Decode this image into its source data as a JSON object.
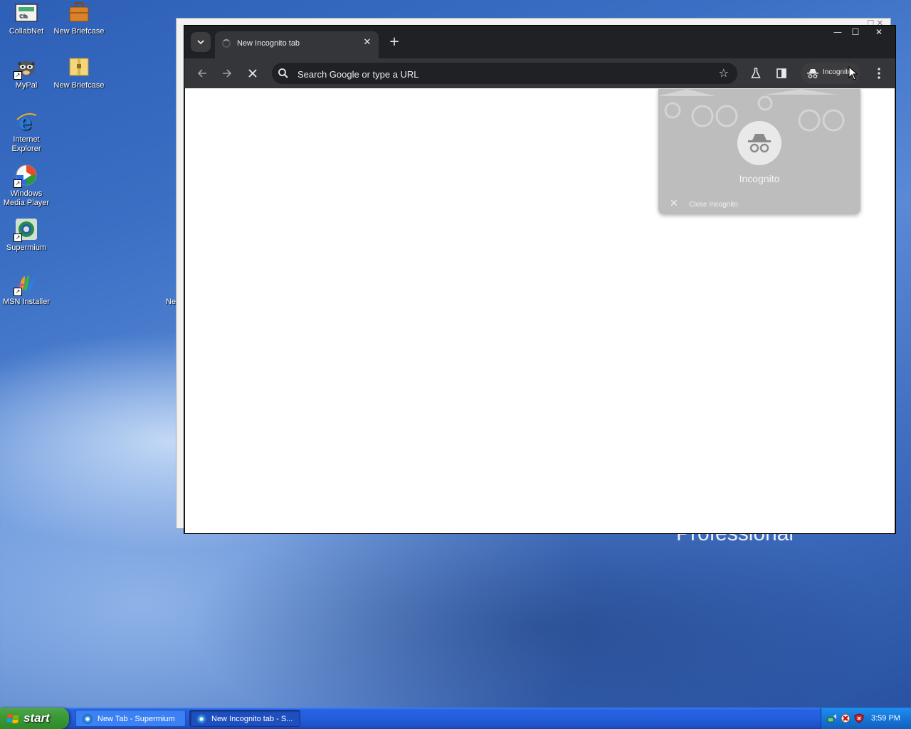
{
  "desktop": {
    "icons": [
      {
        "label": "CollabNet",
        "icon": "collabnet-icon"
      },
      {
        "label": "New Briefcase",
        "icon": "briefcase-icon"
      },
      {
        "label": "MyPal",
        "icon": "mypal-icon"
      },
      {
        "label": "New Briefcase",
        "icon": "briefcase-icon"
      },
      {
        "label": "Internet Explorer",
        "icon": "internet-explorer-icon"
      },
      {
        "label": "Windows Media Player",
        "icon": "windows-media-player-icon"
      },
      {
        "label": "Supermium",
        "icon": "supermium-icon"
      },
      {
        "label": "MSN Installer",
        "icon": "msn-installer-icon"
      }
    ],
    "partial_label": "Ne",
    "wallpaper_text": "Professional"
  },
  "browser": {
    "tab": {
      "title": "New Incognito tab",
      "close": "✕"
    },
    "new_tab": "+",
    "window_controls": {
      "minimize": "—",
      "maximize": "☐",
      "close": "✕"
    },
    "omnibox": {
      "placeholder": "Search Google or type a URL",
      "value": ""
    },
    "profile_chip": {
      "label": "Incognito"
    },
    "colors": {
      "frame": "#202124",
      "toolbar": "#35363a",
      "text": "#e8eaed"
    }
  },
  "incognito_menu": {
    "title": "Incognito",
    "close_label": "Close Incognito"
  },
  "taskbar": {
    "start_label": "start",
    "tasks": [
      {
        "label": "New Tab - Supermium",
        "active": false
      },
      {
        "label": "New Incognito tab - S...",
        "active": true
      }
    ],
    "clock": "3:59 PM"
  }
}
